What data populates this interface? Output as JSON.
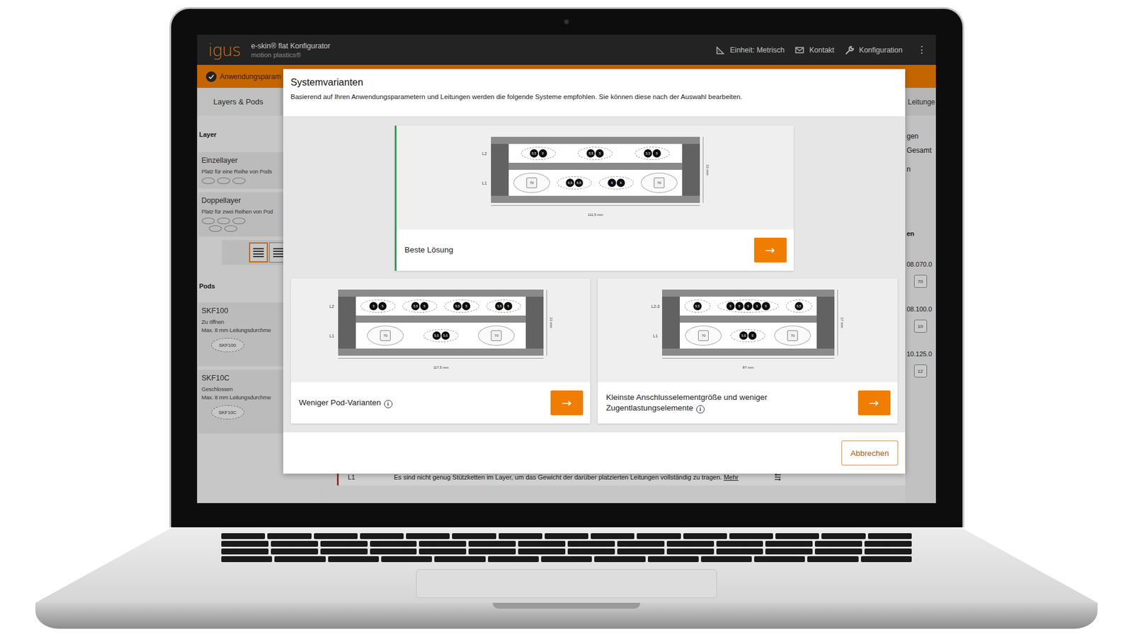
{
  "window": {
    "logo": "igus",
    "title": "e-skin® flat Konfigurator",
    "subtitle": "motion plastics®"
  },
  "toolbar": [
    {
      "label": "Einheit: Metrisch"
    },
    {
      "label": "Kontakt"
    },
    {
      "label": "Konfiguration"
    }
  ],
  "menu_icon": "⋮",
  "steps": [
    {
      "label": "Anwendungsparam",
      "done": true
    }
  ],
  "tabs": [
    {
      "label": "Layers & Pods",
      "selected": true
    },
    {
      "label": "Leitunge",
      "selected": false
    }
  ],
  "sidebar": {
    "layer_heading": "Layer",
    "layers": [
      {
        "title": "Einzellayer",
        "desc": "Platz für eine Reihe von Pods",
        "oval_rows": [
          3
        ]
      },
      {
        "title": "Doppellayer",
        "desc": "Platz für zwei Reihen von Pod",
        "oval_rows": [
          3,
          2
        ]
      }
    ],
    "layer_buttons": [
      {
        "selected": true
      },
      {
        "selected": false
      }
    ],
    "pods_heading": "Pods",
    "pods": [
      {
        "name": "SKF100",
        "desc": "Zu öffnen",
        "limit": "Max. 8 mm Leitungsdurchme",
        "badge": "SKF100"
      },
      {
        "name": "SKF10C",
        "desc": "Geschlossen",
        "limit": "Max. 8 mm Leitungsdurchme",
        "badge": "SKF10C"
      }
    ]
  },
  "right_panel": {
    "lines": [
      "gen",
      "Gesamt",
      "n"
    ],
    "section": "en",
    "items": [
      {
        "code": "08.070.0",
        "size": "70"
      },
      {
        "code": "08.100.0",
        "size": "10"
      },
      {
        "code": "10.125.0",
        "size": "12"
      }
    ]
  },
  "messages": [
    {
      "layer": "L1",
      "text": "Es sind nicht genug Stützketten im Layer, um das Gewicht der darüber platzierten Leitungen vollständig zu tragen.",
      "link": "Mehr"
    }
  ],
  "modal": {
    "title": "Systemvarianten",
    "subtitle": "Basierend auf Ihren Anwendungsparametern und Leitungen werden die folgende Systeme empfohlen. Sie können diese nach der Auswahl bearbeiten.",
    "info_icon": "i",
    "arrow": "→",
    "cancel": "Abbrechen",
    "variants": [
      {
        "title": "Beste Lösung",
        "has_info": false,
        "highlighted": true,
        "diagram": {
          "width": "111,5 mm",
          "height": "33 mm",
          "layers": [
            {
              "label": "L2",
              "pods": [
                {
                  "kind": "cables",
                  "items": [
                    "5,5",
                    "5"
                  ]
                },
                {
                  "kind": "cables",
                  "items": [
                    "5,5",
                    "5"
                  ]
                },
                {
                  "kind": "cables",
                  "items": [
                    "5,5",
                    "5"
                  ]
                }
              ]
            },
            {
              "label": "L1",
              "pods": [
                {
                  "kind": "connector",
                  "items": [
                    "70"
                  ]
                },
                {
                  "kind": "cables",
                  "items": [
                    "6,5",
                    "6,5"
                  ]
                },
                {
                  "kind": "cables",
                  "items": [
                    "6",
                    "6"
                  ]
                },
                {
                  "kind": "connector",
                  "items": [
                    "70"
                  ]
                }
              ]
            }
          ]
        }
      },
      {
        "title": "Weniger Pod-Varianten",
        "has_info": true,
        "highlighted": false,
        "diagram": {
          "width": "117,5 mm",
          "height": "33 mm",
          "layers": [
            {
              "label": "L2",
              "pods": [
                {
                  "kind": "cables",
                  "items": [
                    "5",
                    "5"
                  ]
                },
                {
                  "kind": "cables",
                  "items": [
                    "5,5",
                    "5"
                  ]
                },
                {
                  "kind": "cables",
                  "items": [
                    "5,5",
                    "5"
                  ]
                },
                {
                  "kind": "cables",
                  "items": [
                    "5,5",
                    "5"
                  ]
                }
              ]
            },
            {
              "label": "L1",
              "pods": [
                {
                  "kind": "connector",
                  "items": [
                    "70"
                  ]
                },
                {
                  "kind": "cables",
                  "items": [
                    "5,5",
                    "5,5"
                  ]
                },
                {
                  "kind": "connector",
                  "items": [
                    "70"
                  ]
                }
              ]
            }
          ]
        }
      },
      {
        "title": "Kleinste Anschlusselementgröße und weniger Zugentlastungselemente",
        "has_info": true,
        "highlighted": false,
        "diagram": {
          "width": "87 mm",
          "height": "37 mm",
          "layers": [
            {
              "label": "L2-3",
              "pods": [
                {
                  "kind": "cables",
                  "items": [
                    "5,5"
                  ]
                },
                {
                  "kind": "cables",
                  "items": [
                    "5",
                    "5",
                    "5",
                    "5",
                    "5"
                  ]
                },
                {
                  "kind": "cables",
                  "items": [
                    "5,5"
                  ]
                }
              ]
            },
            {
              "label": "L1",
              "pods": [
                {
                  "kind": "connector",
                  "items": [
                    "70"
                  ]
                },
                {
                  "kind": "cables",
                  "items": [
                    "5,5",
                    "5"
                  ]
                },
                {
                  "kind": "connector",
                  "items": [
                    "70"
                  ]
                }
              ]
            }
          ]
        }
      }
    ]
  }
}
